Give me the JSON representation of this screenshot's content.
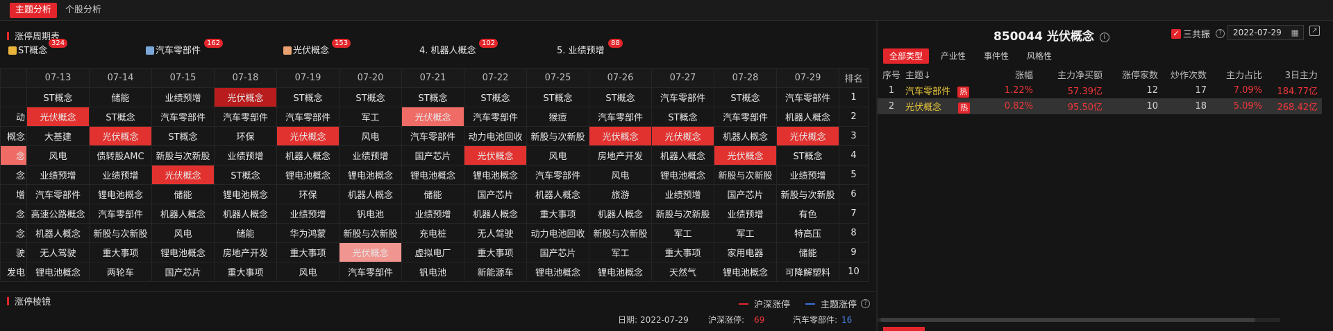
{
  "top_tabs": [
    "主题分析",
    "个股分析"
  ],
  "section1_title": "涨停周期表",
  "tags": [
    {
      "label": "ST概念",
      "count": "324",
      "color": "#e8b53a"
    },
    {
      "label": "汽车零部件",
      "count": "162",
      "color": "#7aa6d8"
    },
    {
      "label": "光伏概念",
      "count": "153",
      "color": "#e8a070"
    },
    {
      "label": "4. 机器人概念",
      "count": "102",
      "color": ""
    },
    {
      "label": "5. 业绩预增",
      "count": "88",
      "color": ""
    }
  ],
  "grid": {
    "dates": [
      "07-13",
      "07-14",
      "07-15",
      "07-18",
      "07-19",
      "07-20",
      "07-21",
      "07-22",
      "07-25",
      "07-26",
      "07-27",
      "07-28",
      "07-29"
    ],
    "rank_header": "排名",
    "first_col": [
      "",
      "动",
      "概念",
      "念",
      "念",
      "增",
      "念",
      "念",
      "驶",
      "发电"
    ],
    "rows": [
      [
        "ST概念",
        "储能",
        "业绩预增",
        "光伏概念",
        "ST概念",
        "ST概念",
        "ST概念",
        "ST概念",
        "ST概念",
        "ST概念",
        "汽车零部件",
        "ST概念",
        "汽车零部件",
        "1"
      ],
      [
        "光伏概念",
        "ST概念",
        "汽车零部件",
        "汽车零部件",
        "汽车零部件",
        "军工",
        "光伏概念",
        "汽车零部件",
        "猴痘",
        "汽车零部件",
        "ST概念",
        "汽车零部件",
        "机器人概念",
        "2"
      ],
      [
        "大基建",
        "光伏概念",
        "ST概念",
        "环保",
        "光伏概念",
        "风电",
        "汽车零部件",
        "动力电池回收",
        "新股与次新股",
        "光伏概念",
        "光伏概念",
        "机器人概念",
        "光伏概念",
        "3"
      ],
      [
        "风电",
        "债转股AMC",
        "新股与次新股",
        "业绩预增",
        "机器人概念",
        "业绩预增",
        "国产芯片",
        "光伏概念",
        "风电",
        "房地产开发",
        "机器人概念",
        "光伏概念",
        "ST概念",
        "4"
      ],
      [
        "业绩预增",
        "业绩预增",
        "光伏概念",
        "ST概念",
        "锂电池概念",
        "锂电池概念",
        "锂电池概念",
        "锂电池概念",
        "汽车零部件",
        "风电",
        "锂电池概念",
        "新股与次新股",
        "业绩预增",
        "5"
      ],
      [
        "汽车零部件",
        "锂电池概念",
        "储能",
        "锂电池概念",
        "环保",
        "机器人概念",
        "储能",
        "国产芯片",
        "机器人概念",
        "旅游",
        "业绩预增",
        "国产芯片",
        "新股与次新股",
        "6"
      ],
      [
        "高速公路概念",
        "汽车零部件",
        "机器人概念",
        "机器人概念",
        "业绩预增",
        "钒电池",
        "业绩预增",
        "机器人概念",
        "重大事项",
        "机器人概念",
        "新股与次新股",
        "业绩预增",
        "有色",
        "7"
      ],
      [
        "机器人概念",
        "新股与次新股",
        "风电",
        "储能",
        "华为鸿蒙",
        "新股与次新股",
        "充电桩",
        "无人驾驶",
        "动力电池回收",
        "新股与次新股",
        "军工",
        "军工",
        "特高压",
        "8"
      ],
      [
        "无人驾驶",
        "重大事项",
        "锂电池概念",
        "房地产开发",
        "重大事项",
        "光伏概念",
        "虚拟电厂",
        "重大事项",
        "国产芯片",
        "军工",
        "重大事项",
        "家用电器",
        "储能",
        "9"
      ],
      [
        "锂电池概念",
        "两轮车",
        "国产芯片",
        "重大事项",
        "风电",
        "汽车零部件",
        "钒电池",
        "新能源车",
        "锂电池概念",
        "锂电池概念",
        "天然气",
        "锂电池概念",
        "可降解塑料",
        "10"
      ]
    ]
  },
  "section2_title": "涨停棱镜",
  "legend": {
    "a": "沪深涨停",
    "b": "主题涨停",
    "a_color": "#e3262b",
    "b_color": "#3b6fd8"
  },
  "bottom_info": {
    "date_label": "日期:",
    "date": "2022-07-29",
    "hs_label": "沪深涨停:",
    "hs_value": "69",
    "theme_label": "汽车零部件:",
    "theme_value": "16"
  },
  "right": {
    "title": "850044 光伏概念",
    "checkbox_label": "三共振",
    "checkbox_checked": true,
    "date": "2022-07-29",
    "filter_tabs": [
      "全部类型",
      "产业性",
      "事件性",
      "风格性"
    ],
    "headers": [
      "序号",
      "主题↓",
      "涨幅",
      "主力净买额",
      "涨停家数",
      "炒作次数",
      "主力占比",
      "3日主力"
    ],
    "rows": [
      {
        "no": "1",
        "name": "汽车零部件",
        "badge": "热",
        "chg": "1.22%",
        "net": "57.39亿",
        "up": "12",
        "times": "17",
        "ratio": "7.09%",
        "d3": "184.77亿"
      },
      {
        "no": "2",
        "name": "光伏概念",
        "badge": "热",
        "chg": "0.82%",
        "net": "95.50亿",
        "up": "10",
        "times": "18",
        "ratio": "5.09%",
        "d3": "268.42亿"
      }
    ]
  }
}
